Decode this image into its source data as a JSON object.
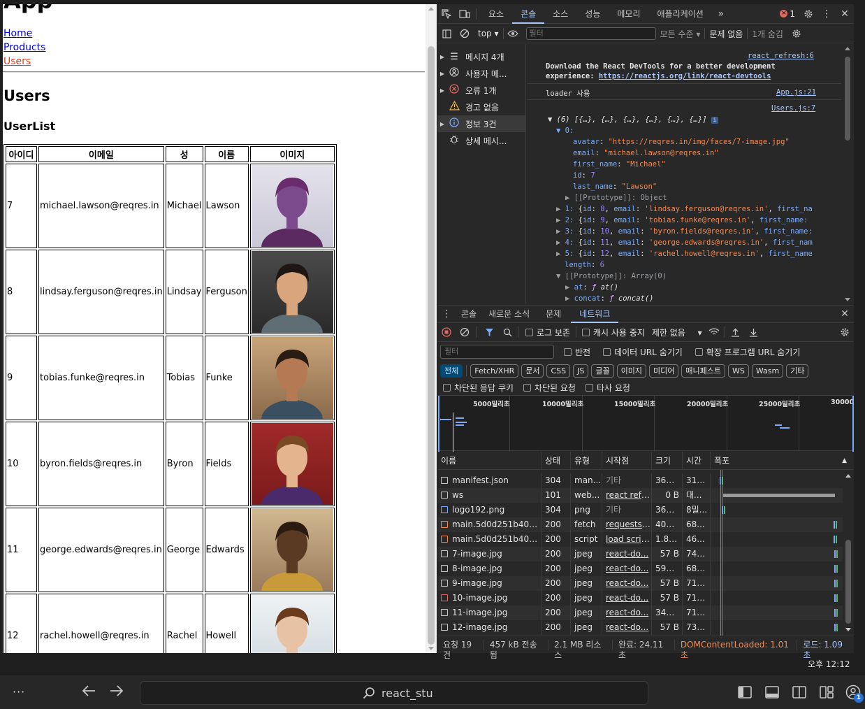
{
  "app": {
    "title": "App",
    "nav": [
      "Home",
      "Products",
      "Users"
    ],
    "users_heading": "Users",
    "userlist_heading": "UserList",
    "table_headers": [
      "아이디",
      "이메일",
      "성",
      "이름",
      "이미지"
    ],
    "users": [
      {
        "id": "7",
        "email": "michael.lawson@reqres.in",
        "first": "Michael",
        "last": "Lawson"
      },
      {
        "id": "8",
        "email": "lindsay.ferguson@reqres.in",
        "first": "Lindsay",
        "last": "Ferguson"
      },
      {
        "id": "9",
        "email": "tobias.funke@reqres.in",
        "first": "Tobias",
        "last": "Funke"
      },
      {
        "id": "10",
        "email": "byron.fields@reqres.in",
        "first": "Byron",
        "last": "Fields"
      },
      {
        "id": "11",
        "email": "george.edwards@reqres.in",
        "first": "George",
        "last": "Edwards"
      },
      {
        "id": "12",
        "email": "rachel.howell@reqres.in",
        "first": "Rachel",
        "last": "Howell"
      }
    ]
  },
  "devtools": {
    "tabs": [
      "요소",
      "콘솔",
      "소스",
      "성능",
      "메모리",
      "애플리케이션"
    ],
    "error_count": "1",
    "console_toolbar": {
      "context": "top",
      "filter_placeholder": "필터",
      "levels": "모든 수준",
      "issues": "문제 없음",
      "hidden": "1개 숨김"
    },
    "sidebar": [
      "메시지 4개",
      "사용자 메...",
      "오류 1개",
      "경고 없음",
      "정보 3건",
      "상세 메시..."
    ],
    "console": {
      "src1": "react_refresh:6",
      "devtools_msg1": "Download the React DevTools for a better development",
      "devtools_msg2": "experience: ",
      "devtools_link": "https://reactjs.org/link/react-devtools",
      "loader": "loader 사용",
      "src2": "App.js:21",
      "src3": "Users.js:7",
      "array_summary": "▼ (6) [{…}, {…}, {…}, {…}, {…}, {…}]",
      "idx0": "▼ 0:",
      "avatar_key": "avatar",
      "avatar_val": "\"https://reqres.in/img/faces/7-image.jpg\"",
      "email_key": "email",
      "email_val": "\"michael.lawson@reqres.in\"",
      "first_key": "first_name",
      "first_val": "\"Michael\"",
      "id_key": "id",
      "id_val": "7",
      "last_key": "last_name",
      "last_val": "\"Lawson\"",
      "proto_obj": "▶ [[Prototype]]: Object",
      "rows": [
        {
          "idx": "1",
          "id": "8",
          "email": "'lindsay.ferguson@reqres.in'",
          "tail": "first_na"
        },
        {
          "idx": "2",
          "id": "9",
          "email": "'tobias.funke@reqres.in'",
          "tail": "first_name:"
        },
        {
          "idx": "3",
          "id": "10",
          "email": "'byron.fields@reqres.in'",
          "tail": "first_name:"
        },
        {
          "idx": "4",
          "id": "11",
          "email": "'george.edwards@reqres.in'",
          "tail": "first_nam"
        },
        {
          "idx": "5",
          "id": "12",
          "email": "'rachel.howell@reqres.in'",
          "tail": "first_name"
        }
      ],
      "length_key": "length",
      "length_val": "6",
      "proto_arr": "[[Prototype]]: Array(0)",
      "at_fn": "at()",
      "concat_fn": "concat()"
    },
    "drawer_tabs": [
      "콘솔",
      "새로운 소식",
      "문제",
      "네트워크"
    ],
    "network": {
      "preserve_log": "로그 보존",
      "disable_cache": "캐시 사용 중지",
      "throttle": "제한 없음",
      "filter_placeholder": "필터",
      "invert": "반전",
      "hide_data_urls": "데이터 URL 숨기기",
      "hide_ext_urls": "확장 프로그램 URL 숨기기",
      "types": [
        "전체",
        "Fetch/XHR",
        "문서",
        "CSS",
        "JS",
        "글꼴",
        "이미지",
        "미디어",
        "매니페스트",
        "WS",
        "Wasm",
        "기타"
      ],
      "blocked_cookies": "차단된 응답 쿠키",
      "blocked_requests": "차단된 요청",
      "third_party": "타사 요청",
      "timeline_labels": [
        "5000밀리초",
        "10000밀리초",
        "15000밀리초",
        "20000밀리초",
        "25000밀리초",
        "30000"
      ],
      "columns": [
        "이름",
        "상태",
        "유형",
        "시작점",
        "크기",
        "시간",
        "폭포"
      ],
      "rows": [
        {
          "name": "manifest.json",
          "status": "304",
          "type": "man...",
          "initiator": "기타",
          "size": "363 B",
          "time": "319..."
        },
        {
          "name": "ws",
          "status": "101",
          "type": "web...",
          "initiator": "react refre...",
          "size": "0 B",
          "time": "대..."
        },
        {
          "name": "logo192.png",
          "status": "304",
          "type": "png",
          "initiator": "기타",
          "size": "364 B",
          "time": "8밀..."
        },
        {
          "name": "main.5d0d251b40ca...",
          "status": "200",
          "type": "fetch",
          "initiator": "requests.j...",
          "size": "406 B",
          "time": "68..."
        },
        {
          "name": "main.5d0d251b40ca...",
          "status": "200",
          "type": "script",
          "initiator": "load scrip...",
          "size": "1.8 kB",
          "time": "46..."
        },
        {
          "name": "7-image.jpg",
          "status": "200",
          "type": "jpeg",
          "initiator": "react-do...",
          "size": "57 B",
          "time": "745..."
        },
        {
          "name": "8-image.jpg",
          "status": "200",
          "type": "jpeg",
          "initiator": "react-do...",
          "size": "597 B",
          "time": "682..."
        },
        {
          "name": "9-image.jpg",
          "status": "200",
          "type": "jpeg",
          "initiator": "react-do...",
          "size": "57 B",
          "time": "712..."
        },
        {
          "name": "10-image.jpg",
          "status": "200",
          "type": "jpeg",
          "initiator": "react-do...",
          "size": "57 B",
          "time": "711..."
        },
        {
          "name": "11-image.jpg",
          "status": "200",
          "type": "jpeg",
          "initiator": "react-do...",
          "size": "347 B",
          "time": "710..."
        },
        {
          "name": "12-image.jpg",
          "status": "200",
          "type": "jpeg",
          "initiator": "react-do...",
          "size": "57 B",
          "time": "732..."
        }
      ],
      "status_bar": {
        "requests": "요청 19건",
        "transferred": "457 kB 전송됨",
        "resources": "2.1 MB 리소스",
        "finish": "완료: 24.11초",
        "dcl": "DOMContentLoaded: 1.01초",
        "load": "로드: 1.09초"
      }
    }
  },
  "taskbar": {
    "search_label": "react_stu",
    "clock": "오후 12:12",
    "notif_count": "1"
  }
}
